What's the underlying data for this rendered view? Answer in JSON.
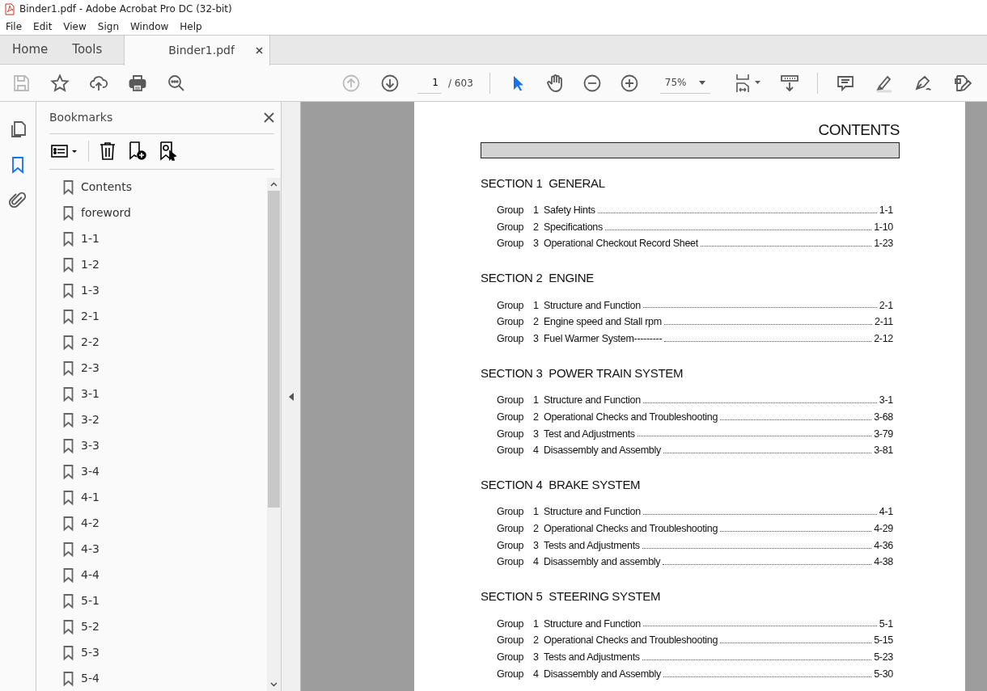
{
  "window": {
    "title": "Binder1.pdf - Adobe Acrobat Pro DC (32-bit)"
  },
  "menu": [
    "File",
    "Edit",
    "View",
    "Sign",
    "Window",
    "Help"
  ],
  "tabs": [
    {
      "label": "Home",
      "selected": false
    },
    {
      "label": "Tools",
      "selected": false
    },
    {
      "label": "Binder1.pdf",
      "selected": true
    }
  ],
  "toolbar": {
    "left": [
      {
        "kind": "save",
        "disabled": true
      },
      {
        "kind": "star",
        "disabled": false
      },
      {
        "kind": "upload",
        "disabled": false
      },
      {
        "kind": "print",
        "disabled": false
      },
      {
        "kind": "find",
        "disabled": false
      }
    ],
    "nav": [
      {
        "kind": "prev",
        "disabled": true
      },
      {
        "kind": "next",
        "disabled": false
      }
    ],
    "page": {
      "value": "1",
      "total": "/ 603"
    },
    "tools": [
      {
        "kind": "select",
        "selected": true
      },
      {
        "kind": "hand",
        "selected": false
      },
      {
        "kind": "zoomout",
        "selected": false
      },
      {
        "kind": "zoomin",
        "selected": false
      }
    ],
    "zoom": "75%",
    "right": [
      {
        "kind": "comment"
      },
      {
        "kind": "highlight"
      },
      {
        "kind": "sign"
      },
      {
        "kind": "edit"
      }
    ]
  },
  "rail": [
    {
      "kind": "pages",
      "selected": false
    },
    {
      "kind": "bookmarks",
      "selected": true
    },
    {
      "kind": "attachments",
      "selected": false
    }
  ],
  "bookmarks": {
    "title": "Bookmarks",
    "items": [
      {
        "label": "Contents"
      },
      {
        "label": "foreword"
      },
      {
        "label": "1-1"
      },
      {
        "label": "1-2"
      },
      {
        "label": "1-3"
      },
      {
        "label": "2-1"
      },
      {
        "label": "2-2"
      },
      {
        "label": "2-3"
      },
      {
        "label": "3-1"
      },
      {
        "label": "3-2"
      },
      {
        "label": "3-3"
      },
      {
        "label": "3-4"
      },
      {
        "label": "4-1"
      },
      {
        "label": "4-2"
      },
      {
        "label": "4-3"
      },
      {
        "label": "4-4"
      },
      {
        "label": "5-1"
      },
      {
        "label": "5-2"
      },
      {
        "label": "5-3"
      },
      {
        "label": "5-4"
      }
    ]
  },
  "document": {
    "heading": "CONTENTS",
    "sections": [
      {
        "title": "SECTION 1  GENERAL",
        "groups": [
          {
            "label": "Group",
            "number": "1",
            "title": "Safety Hints",
            "page": "1-1"
          },
          {
            "label": "Group",
            "number": "2",
            "title": "Specifications",
            "page": "1-10"
          },
          {
            "label": "Group",
            "number": "3",
            "title": "Operational Checkout Record Sheet",
            "page": "1-23"
          }
        ]
      },
      {
        "title": "SECTION 2  ENGINE",
        "groups": [
          {
            "label": "Group",
            "number": "1",
            "title": "Structure and Function",
            "page": "2-1"
          },
          {
            "label": "Group",
            "number": "2",
            "title": "Engine speed and Stall rpm",
            "page": "2-11"
          },
          {
            "label": "Group",
            "number": "3",
            "title": "Fuel Warmer System---------",
            "page": "2-12"
          }
        ]
      },
      {
        "title": "SECTION 3  POWER TRAIN SYSTEM",
        "groups": [
          {
            "label": "Group",
            "number": "1",
            "title": "Structure and Function",
            "page": "3-1"
          },
          {
            "label": "Group",
            "number": "2",
            "title": "Operational Checks and Troubleshooting",
            "page": "3-68"
          },
          {
            "label": "Group",
            "number": "3",
            "title": "Test and Adjustments",
            "page": "3-79"
          },
          {
            "label": "Group",
            "number": "4",
            "title": "Disassembly and Assembly",
            "page": "3-81"
          }
        ]
      },
      {
        "title": "SECTION 4  BRAKE SYSTEM",
        "groups": [
          {
            "label": "Group",
            "number": "1",
            "title": "Structure and Function",
            "page": "4-1"
          },
          {
            "label": "Group",
            "number": "2",
            "title": "Operational Checks and Troubleshooting",
            "page": "4-29"
          },
          {
            "label": "Group",
            "number": "3",
            "title": "Tests and Adjustments",
            "page": "4-36"
          },
          {
            "label": "Group",
            "number": "4",
            "title": "Disassembly and assembly",
            "page": "4-38"
          }
        ]
      },
      {
        "title": "SECTION 5  STEERING SYSTEM",
        "groups": [
          {
            "label": "Group",
            "number": "1",
            "title": "Structure and Function",
            "page": "5-1"
          },
          {
            "label": "Group",
            "number": "2",
            "title": "Operational Checks and Troubleshooting",
            "page": "5-15"
          },
          {
            "label": "Group",
            "number": "3",
            "title": "Tests and Adjustments",
            "page": "5-23"
          },
          {
            "label": "Group",
            "number": "4",
            "title": "Disassembly and Assembly",
            "page": "5-30"
          }
        ]
      }
    ]
  }
}
